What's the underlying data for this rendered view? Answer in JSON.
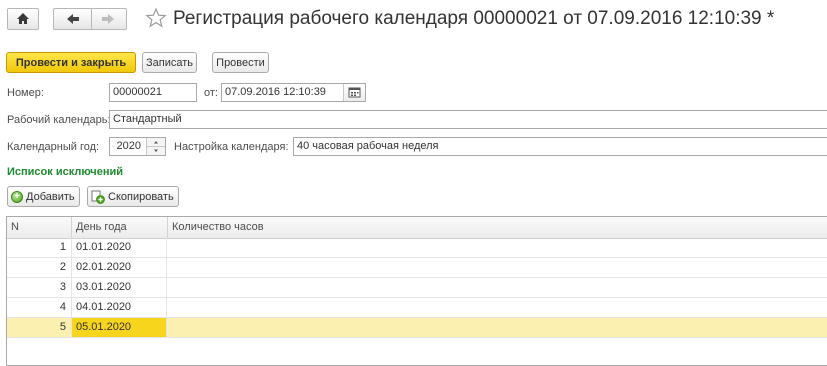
{
  "nav": {
    "home_icon": "home-icon",
    "back_icon": "arrow-left-icon",
    "forward_icon": "arrow-right-icon",
    "star_icon": "star-icon"
  },
  "title": "Регистрация рабочего календаря 00000021 от 07.09.2016 12:10:39 *",
  "toolbar": {
    "post_close_label": "Провести и закрыть",
    "save_label": "Записать",
    "post_label": "Провести"
  },
  "form": {
    "number_label": "Номер:",
    "number_value": "00000021",
    "date_label": "от:",
    "date_value": "07.09.2016 12:10:39",
    "calendar_label": "Рабочий календарь:",
    "calendar_value": "Стандартный",
    "year_label": "Календарный год:",
    "year_value": "2020",
    "settings_label": "Настройка календаря:",
    "settings_value": "40 часовая рабочая неделя"
  },
  "exceptions": {
    "title": "Исписок исключений",
    "add_label": "Добавить",
    "copy_label": "Скопировать",
    "columns": {
      "n": "N",
      "day": "День года",
      "hours": "Количество часов"
    },
    "rows": [
      {
        "n": "1",
        "day": "01.01.2020",
        "hours": ""
      },
      {
        "n": "2",
        "day": "02.01.2020",
        "hours": ""
      },
      {
        "n": "3",
        "day": "03.01.2020",
        "hours": ""
      },
      {
        "n": "4",
        "day": "04.01.2020",
        "hours": ""
      },
      {
        "n": "5",
        "day": "05.01.2020",
        "hours": ""
      }
    ],
    "selected_row": 5
  },
  "colors": {
    "primary_button": "#f5d21f",
    "selected_row": "#fbf0b0",
    "selected_cell": "#f7d51d",
    "section_title": "#1d8a2e"
  }
}
